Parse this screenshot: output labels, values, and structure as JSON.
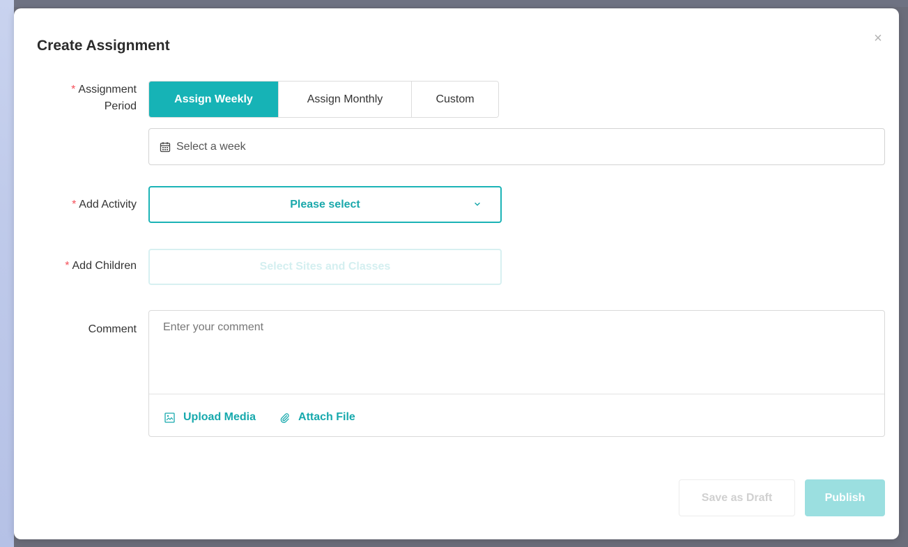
{
  "modal": {
    "title": "Create Assignment",
    "close_symbol": "×"
  },
  "period": {
    "label_line1": "Assignment",
    "label_line2": "Period",
    "required_mark": "*",
    "options": [
      "Assign Weekly",
      "Assign Monthly",
      "Custom"
    ],
    "selected": "Assign Weekly",
    "week_placeholder": "Select a week"
  },
  "activity": {
    "label": "Add Activity",
    "required_mark": "*",
    "placeholder": "Please select"
  },
  "children": {
    "label": "Add Children",
    "required_mark": "*",
    "button_label": "Select Sites and Classes"
  },
  "comment": {
    "label": "Comment",
    "placeholder": "Enter your comment",
    "upload_media_label": "Upload Media",
    "attach_file_label": "Attach File"
  },
  "footer": {
    "draft_label": "Save as Draft",
    "publish_label": "Publish"
  },
  "colors": {
    "accent": "#16b3b6",
    "required": "#f5505a",
    "publish_disabled": "#9bdfe0"
  },
  "icons": {
    "week": "calendar-icon",
    "activity": "chevron-down-icon",
    "upload": "image-icon",
    "attach": "paperclip-icon",
    "close": "close-icon"
  }
}
